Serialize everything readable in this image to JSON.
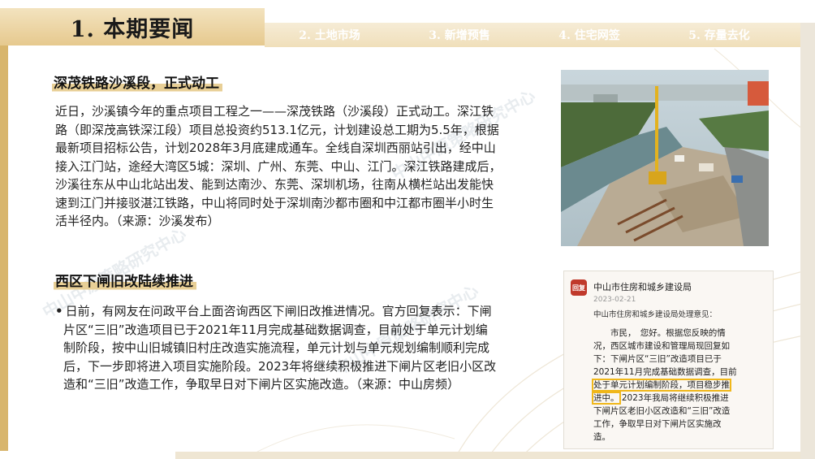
{
  "header": {
    "title": "1. 本期要闻",
    "tabs": [
      "2. 土地市场",
      "3. 新增预售",
      "4. 住宅网签",
      "5. 存量去化"
    ]
  },
  "section1": {
    "heading": "深茂铁路沙溪段，正式动工",
    "body": "近日，沙溪镇今年的重点项目工程之一——深茂铁路（沙溪段）正式动工。深江铁路（即深茂高铁深江段）项目总投资约513.1亿元，计划建设总工期为5.5年，根据最新项目招标公告，计划2028年3月底建成通车。全线自深圳西丽站引出，经中山接入江门站，途经大湾区5城：深圳、广州、东莞、中山、江门。深江铁路建成后，沙溪往东从中山北站出发、能到达南沙、东莞、深圳机场，往南从横栏站出发能快速到江门并接驳湛江铁路，中山将同时处于深圳南沙都市圈和中江都市圈半小时生活半径内。（来源：沙溪发布）",
    "lines": [
      "近日，沙溪镇今年的重点项目工程之一——深茂铁路（沙溪段）正式动工。深江铁",
      "路（即深茂高铁深江段）项目总投资约513.1亿元，计划建设总工期为5.5年，根据",
      "最新项目招标公告，计划2028年3月底建成通车。全线自深圳西丽站引出，经中山",
      "接入江门站，途经大湾区5城：深圳、广州、东莞、中山、江门。深江铁路建成后，",
      "沙溪往东从中山北站出发、能到达南沙、东莞、深圳机场，往南从横栏站出发能快",
      "速到江门并接驳湛江铁路，中山将同时处于深圳南沙都市圈和中江都市圈半小时生",
      "活半径内。（来源：沙溪发布）"
    ]
  },
  "section2": {
    "heading": "西区下闸旧改陆续推进",
    "bullet": "•",
    "lines": [
      "日前，有网友在问政平台上面咨询西区下闸旧改推进情况。官方回复表示：下闸",
      "片区“三旧”改造项目已于2021年11月完成基础数据调查，目前处于单元计划编",
      "制阶段，按中山旧城镇旧村庄改造实施流程，单元计划与单元规划编制顺利完成",
      "后，下一步即将进入项目实施阶段。2023年将继续积极推进下闸片区老旧小区改",
      "造和“三旧”改造工作，争取早日对下闸片区实施改造。（来源：中山房频）"
    ]
  },
  "reply_card": {
    "icon_text": "回复",
    "org": "中山市住房和城乡建设局",
    "date": "2023-02-21",
    "subtitle": "中山市住房和城乡建设局处理意见：",
    "body_lines": [
      "市民，　您好。根据您反映的情",
      "况，西区城市建设和管理局现回复如",
      "下：下闸片区“三旧”改造项目已于",
      "2021年11月完成基础数据调查，目前",
      "处于单元计划编制阶段，项目稳步推",
      "进中。",
      "2023年我局将继续积极推进",
      "下闸片区老旧小区改造和“三旧”改造",
      "工作，争取早日对下闸片区实施改",
      "造。"
    ]
  },
  "watermark": "中山中原策略研究中心",
  "colors": {
    "gold": "#e6c98e",
    "highlight": "#e8cf96",
    "outline": "#f0b71a"
  }
}
